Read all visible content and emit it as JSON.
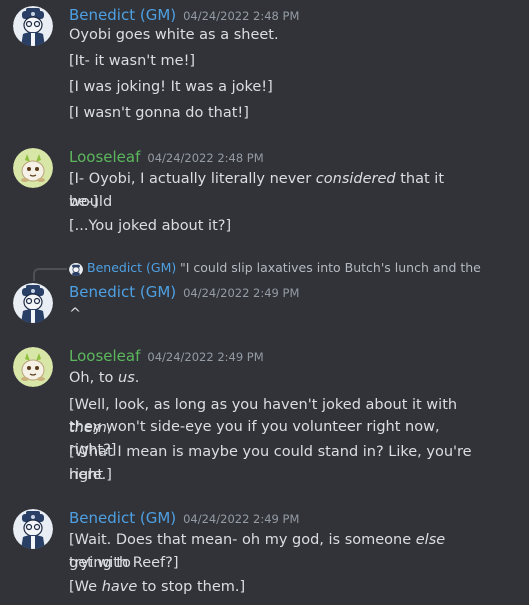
{
  "messages": [
    {
      "author": "Benedict (GM)",
      "timestamp": "04/24/2022 2:48 PM",
      "lines": [
        "Oyobi goes white as a sheet.",
        "[It- it wasn't me!]",
        "[I was joking! It was a joke!]",
        "[I wasn't gonna do that!]"
      ]
    },
    {
      "author": "Looseleaf",
      "timestamp": "04/24/2022 2:48 PM",
      "lines": [
        {
          "pre": "[I- Oyobi, I actually literally never ",
          "em": "considered",
          "post": " that it would"
        },
        "be-]",
        "[...You joked about it?]"
      ]
    },
    {
      "reply": {
        "author": "Benedict (GM)",
        "text": "\"I could slip laxatives into Butch's lunch and then th"
      },
      "author": "Benedict (GM)",
      "timestamp": "04/24/2022 2:49 PM",
      "lines": [
        "^"
      ]
    },
    {
      "author": "Looseleaf",
      "timestamp": "04/24/2022 2:49 PM",
      "lines": [
        {
          "pre": "Oh, to ",
          "em": "us",
          "post": "."
        },
        {
          "pre": "[Well, look, as long as you haven't joked about it with ",
          "em": "them",
          "post": ","
        },
        "they won't side-eye you if you volunteer right now, right?]",
        "[What I mean is maybe you could stand in? Like, you're right",
        "here.]"
      ]
    },
    {
      "author": "Benedict (GM)",
      "timestamp": "04/24/2022 2:49 PM",
      "lines": [
        {
          "pre": "[Wait. Does that mean- oh my god, is someone ",
          "em": "else",
          "post": " trying to"
        },
        "get with Reef?]",
        {
          "pre": "[We ",
          "em": "have",
          "post": " to stop them.]"
        }
      ]
    }
  ],
  "colors": {
    "background": "#313338",
    "gm_name": "#4ea0e3",
    "looseleaf_name": "#5cb85c",
    "message_text": "#dbdee1",
    "timestamp": "#949ba4"
  }
}
